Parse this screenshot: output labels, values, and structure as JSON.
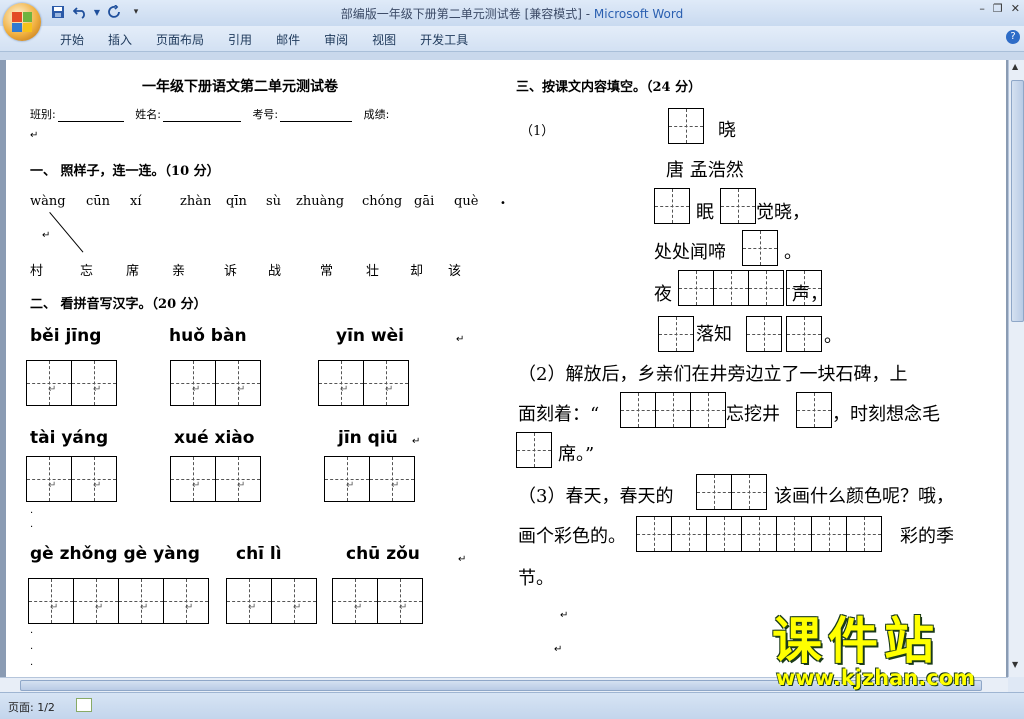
{
  "window": {
    "title": "部编版一年级下册第二单元测试卷 [兼容模式] - ",
    "app": "Microsoft Word",
    "controls": {
      "minimize": "–",
      "restore": "❐",
      "close": "✕"
    }
  },
  "qat": {
    "save_icon": "save-icon",
    "undo_icon": "undo-icon",
    "redo_icon": "redo-icon",
    "customize_icon": "customize-icon"
  },
  "ribbon": {
    "tabs": [
      "开始",
      "插入",
      "页面布局",
      "引用",
      "邮件",
      "审阅",
      "视图",
      "开发工具"
    ],
    "help": "?"
  },
  "status": {
    "page": "页面: 1/2"
  },
  "doc": {
    "title": "一年级下册语文第二单元测试卷",
    "info": {
      "class": "班别:",
      "name": "姓名:",
      "exam_no": "考号:",
      "score": "成绩:"
    },
    "sec1": {
      "heading": "一、 照样子，连一连。（10 分）",
      "pinyin": [
        "wàng",
        "cūn",
        "xí",
        "zhàn",
        "qīn",
        "sù",
        "zhuàng",
        "chóng",
        "gāi",
        "què"
      ],
      "hanzi": [
        "村",
        "忘",
        "席",
        "亲",
        "诉",
        "战",
        "常",
        "壮",
        "却",
        "该"
      ]
    },
    "sec2": {
      "heading": "二、 看拼音写汉字。（20 分）",
      "row1": [
        "běi jīng",
        "huǒ bàn",
        "yīn wèi"
      ],
      "row2": [
        "tài yáng",
        "xué xiào",
        "jīn qiū"
      ],
      "row3": [
        "gè  zhǒng gè  yàng",
        "chī   lì",
        "chū zǒu"
      ]
    },
    "sec3": {
      "heading": "三、按课文内容填空。（24 分）",
      "q1_label": "（1）",
      "poem_title_end": "晓",
      "author": "唐  孟浩然",
      "line1_a": "眠",
      "line1_b": "觉晓，",
      "line2_a": "处处闻啼",
      "line2_b": "。",
      "line3_a": "夜",
      "line3_b": "声，",
      "line4_a": "落知",
      "line4_b": "。",
      "q2_a": "（2）解放后，乡亲们在井旁边立了一块石碑，上",
      "q2_b1": "面刻着：“",
      "q2_b2": "忘挖井",
      "q2_b3": "，时刻想念毛",
      "q2_c": "席。”",
      "q3_a1": "（3）春天，春天的",
      "q3_a2": "该画什么颜色呢？哦，",
      "q3_b1": "画个彩色的。",
      "q3_b2": "彩的季",
      "q3_c": "节。"
    }
  },
  "watermark": {
    "cn": "课件站",
    "en": "www.kjzhan.com"
  }
}
